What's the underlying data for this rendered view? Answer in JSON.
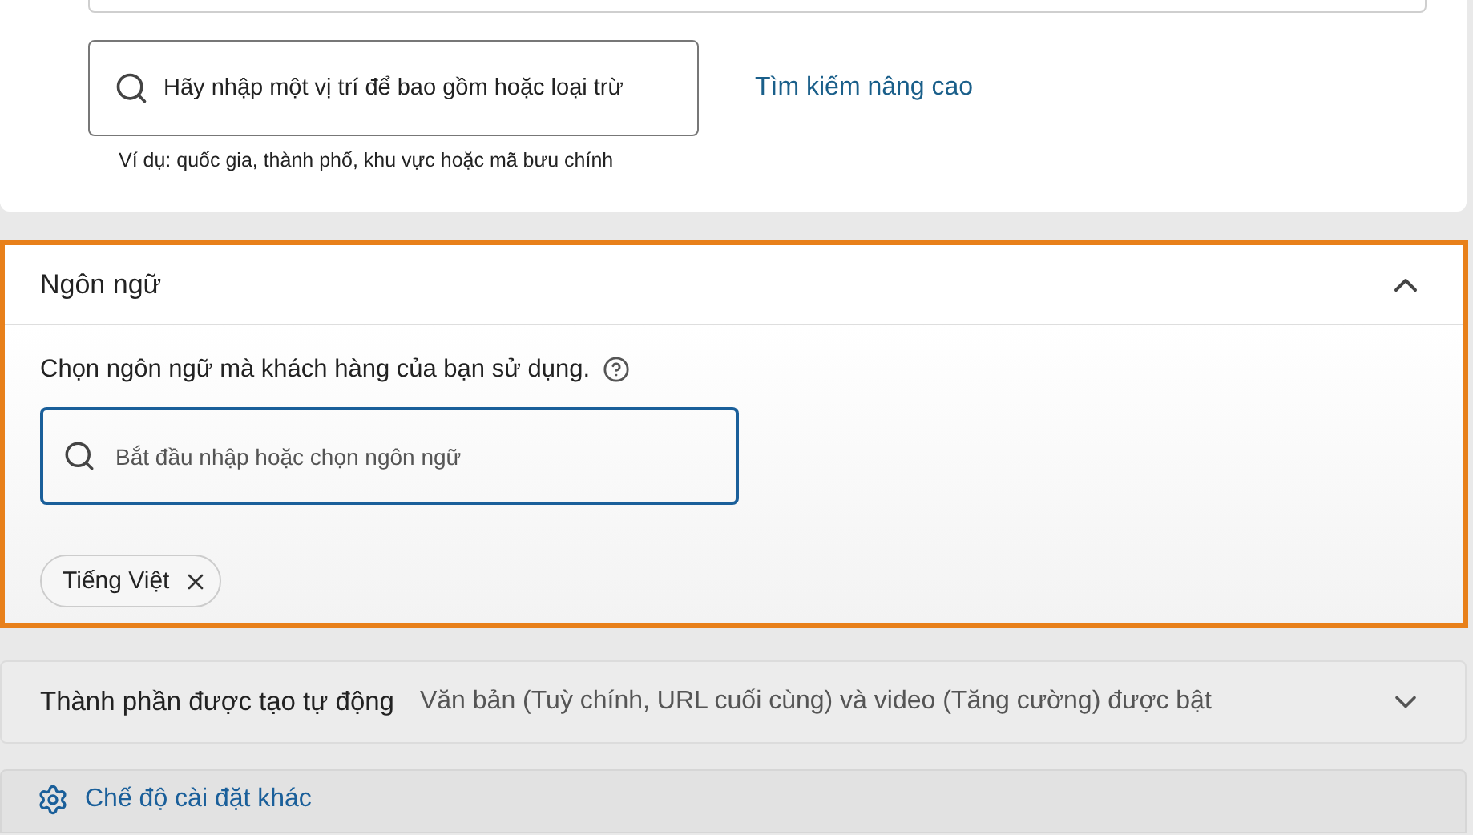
{
  "location": {
    "placeholder": "Hãy nhập một vị trí để bao gồm hoặc loại trừ",
    "hint": "Ví dụ: quốc gia, thành phố, khu vực hoặc mã bưu chính",
    "advanced_link": "Tìm kiếm nâng cao"
  },
  "language_section": {
    "title": "Ngôn ngữ",
    "expanded": true,
    "description": "Chọn ngôn ngữ mà khách hàng của bạn sử dụng.",
    "search": {
      "placeholder": "Bắt đầu nhập hoặc chọn ngôn ngữ"
    },
    "chips": [
      {
        "label": "Tiếng Việt"
      }
    ]
  },
  "collapsed_sections": [
    {
      "title": "Thành phần được tạo tự động",
      "summary": "Văn bản (Tuỳ chính, URL cuối cùng) và video (Tăng cường) được bật",
      "expanded": false
    }
  ],
  "more_settings_link": "Chế độ cài đặt khác"
}
